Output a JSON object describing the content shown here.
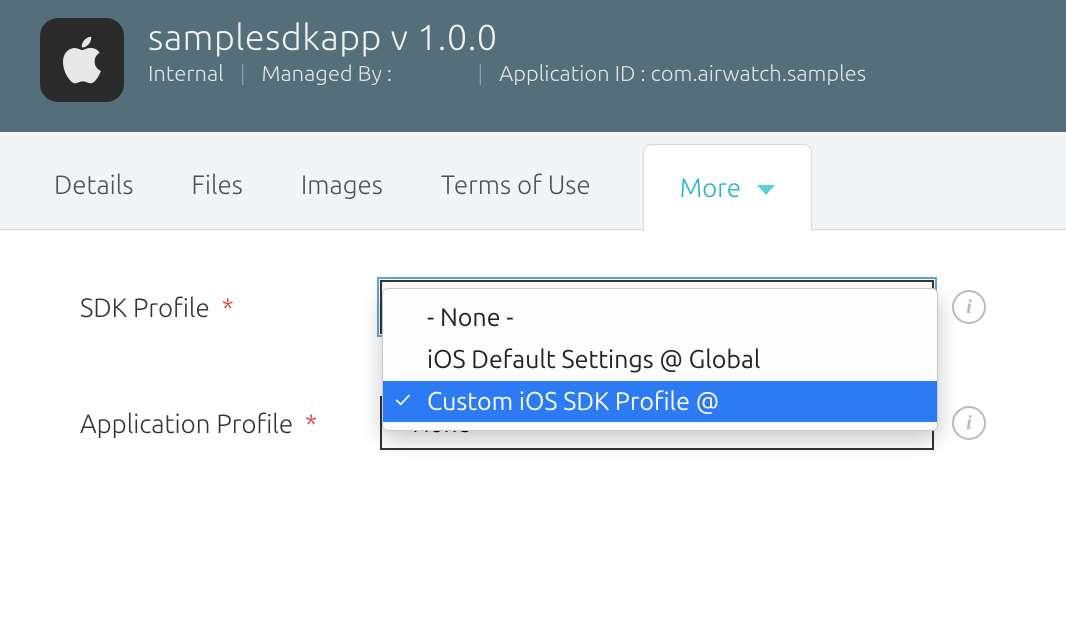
{
  "header": {
    "title": "samplesdkapp v 1.0.0",
    "deployment": "Internal",
    "managed_by_label": "Managed By :",
    "managed_by_value": "",
    "app_id_label": "Application ID : com.airwatch.samples"
  },
  "tabs": {
    "details": "Details",
    "files": "Files",
    "images": "Images",
    "terms": "Terms of Use",
    "more": "More"
  },
  "form": {
    "sdk_profile": {
      "label": "SDK Profile",
      "required": "*",
      "value": ""
    },
    "application_profile": {
      "label": "Application Profile",
      "required": "*",
      "value": "- None -"
    }
  },
  "dropdown": {
    "options": [
      "- None -",
      "iOS Default Settings @ Global",
      "Custom iOS SDK Profile @"
    ],
    "selected_index": 2
  },
  "icons": {
    "info": "i"
  }
}
